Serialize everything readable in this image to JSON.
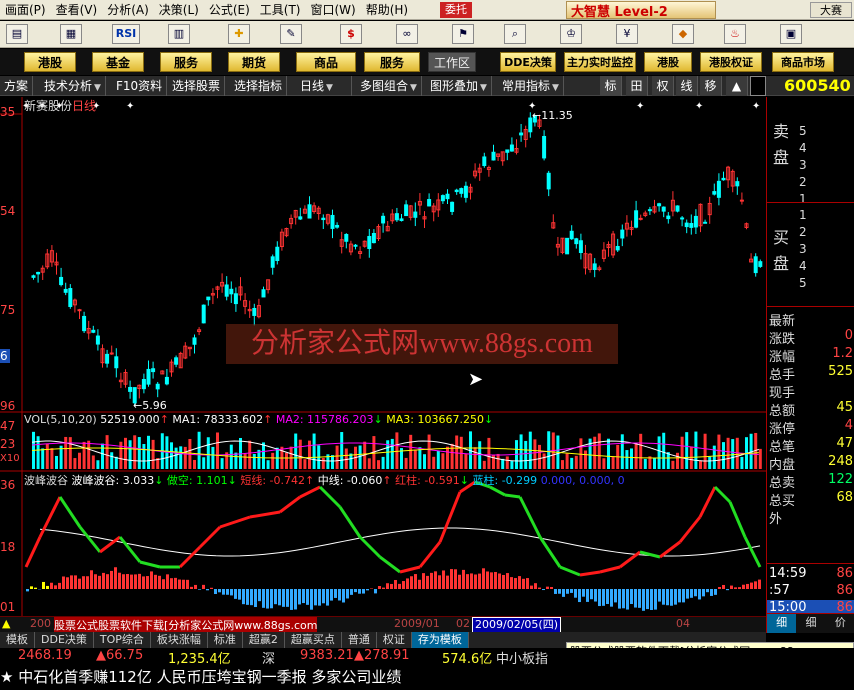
{
  "menubar": {
    "items": [
      "画面(P)",
      "查看(V)",
      "分析(A)",
      "决策(L)",
      "公式(E)",
      "工具(T)",
      "窗口(W)",
      "帮助(H)"
    ],
    "pill": "委托",
    "logo": "大智慧 Level-2",
    "right": "大赛"
  },
  "toolbar1": {
    "icons": [
      "chart-icon",
      "grid-icon",
      "rsi-icon",
      "table-icon",
      "dollar-icon",
      "plus-cross-icon",
      "ruler-icon",
      "yen-icon",
      "goggles-icon",
      "binoculars-icon",
      "trophy-icon",
      "flag-icon",
      "diamond-icon",
      "fire-icon",
      "layout-icon"
    ],
    "rsi": "RSI"
  },
  "toolbar2": {
    "buttons": [
      "港股",
      "基金",
      "服务",
      "期货",
      "商品",
      "服务"
    ],
    "gray": "工作区",
    "right": [
      "DDE决策",
      "主力实时监控",
      "港股",
      "港股权证",
      "商品市场"
    ]
  },
  "toolbar3": {
    "items": [
      "方案",
      "技术分析",
      "F10资料",
      "选择股票",
      "选择指标",
      "日线",
      "多图组合",
      "图形叠加",
      "常用指标"
    ],
    "squares": [
      "标",
      "田",
      "权",
      "线",
      "移",
      "▲"
    ]
  },
  "stock": {
    "code": "600540",
    "name": "新赛股份",
    "period": "日线"
  },
  "price_axis": [
    "35",
    "54",
    "75",
    "96"
  ],
  "annot": {
    "high": "11.35",
    "low": "5.96"
  },
  "vol": {
    "title": "VOL(5,10,20)",
    "val": "52519.000",
    "ma1": "MA1: 78333.602",
    "ma2": "MA2: 115786.203",
    "ma3": "MA3: 103667.250",
    "axis": [
      "47",
      "23",
      "X10"
    ]
  },
  "wave": {
    "title": "波峰波谷",
    "sub": "波峰波谷: 3.033",
    "bull": "做空: 1.101",
    "short": "短线: -0.742",
    "mid": "中线: -0.060",
    "red": "红柱: -0.591",
    "blue": "蓝柱: -0.299",
    "zero": "0.000, 0.000, 0",
    "axis": [
      "36",
      "18",
      "01"
    ]
  },
  "watermark": "分析家公式网www.88gs.com",
  "dates": [
    "200",
    "2009/01",
    "02",
    "2009/02/05(四)",
    "04"
  ],
  "side": {
    "code": "600540",
    "sell": "卖盘",
    "buy": "买盘",
    "sell_rows": [
      "5",
      "4",
      "3",
      "2",
      "1"
    ],
    "buy_rows": [
      "1",
      "2",
      "3",
      "4",
      "5"
    ],
    "fields": [
      [
        "最新",
        ""
      ],
      [
        "涨跌",
        "0"
      ],
      [
        "涨幅",
        "1.2"
      ],
      [
        "总手",
        "525"
      ],
      [
        "现手",
        ""
      ],
      [
        "总额",
        "45"
      ],
      [
        "涨停",
        "4"
      ],
      [
        "总笔",
        "47"
      ],
      [
        "内盘",
        "248"
      ],
      [
        "总卖",
        "122"
      ],
      [
        "总买",
        "68"
      ],
      [
        "外",
        ""
      ]
    ],
    "ticks": [
      [
        "14:59",
        "86"
      ],
      [
        ":57",
        "86"
      ],
      [
        "15:00",
        "86"
      ]
    ],
    "tabs": [
      "细",
      "细",
      "价"
    ]
  },
  "bottom_tabs": [
    "模板",
    "DDE决策",
    "TOP综合",
    "板块涨幅",
    "标准",
    "超赢2",
    "超赢买点",
    "普通",
    "权证",
    "存为模板"
  ],
  "index_bar": {
    "sh": "2468.19",
    "sh_chg": "▲66.75",
    "sh_amt": "1,235.4亿",
    "sz_label": "深",
    "sz": "9383.21",
    "sz_chg": "▲278.91",
    "sz_amt": "574.6亿",
    "zx": "中小板指"
  },
  "promo": "股票公式股票软件下载[分析家公式网www.88gs.com",
  "ticker": "★ 中石化首季赚112亿 人民币压垮宝钢一季报 多家公司业绩",
  "colors": {
    "up": "#ff3333",
    "down": "#00ffff",
    "ma1": "#ffffff",
    "ma2": "#ff00ff",
    "ma3": "#ffff00"
  }
}
